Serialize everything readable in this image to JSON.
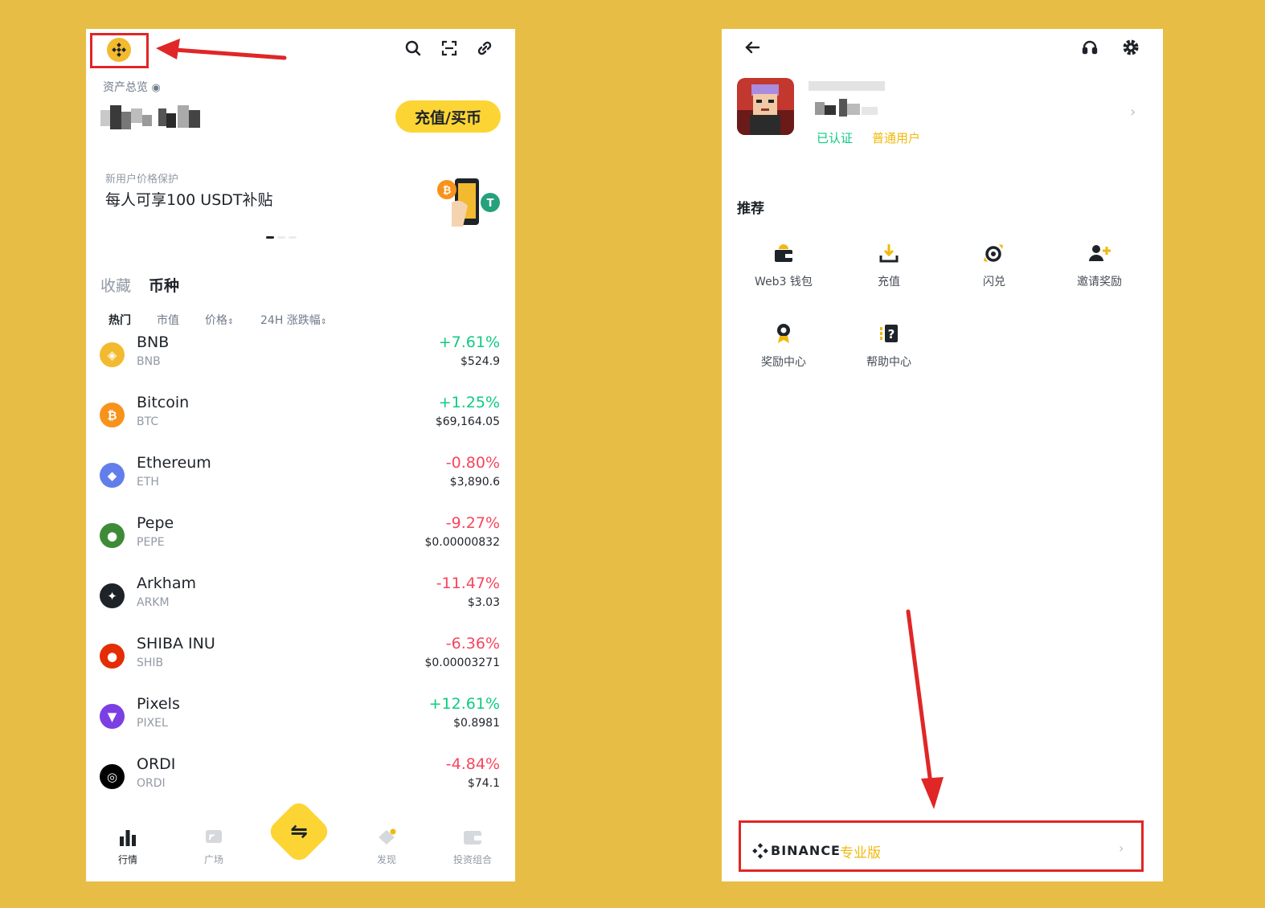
{
  "left": {
    "header": {
      "icons": [
        "binance-logo-icon",
        "search-icon",
        "scan-icon",
        "link-icon"
      ]
    },
    "assets": {
      "overview_label": "资产总览",
      "deposit_button": "充值/买币"
    },
    "promo": {
      "subtitle": "新用户价格保护",
      "title": "每人可享100 USDT补贴"
    },
    "tabs": {
      "favorites": "收藏",
      "coins": "币种"
    },
    "filters": {
      "hot": "热门",
      "market_cap": "市值",
      "price": "价格",
      "change_24h": "24H 涨跌幅"
    },
    "coins": [
      {
        "name": "BNB",
        "symbol": "BNB",
        "change": "+7.61%",
        "price": "$524.9",
        "color": "#f3ba2f"
      },
      {
        "name": "Bitcoin",
        "symbol": "BTC",
        "change": "+1.25%",
        "price": "$69,164.05",
        "color": "#f7931a"
      },
      {
        "name": "Ethereum",
        "symbol": "ETH",
        "change": "-0.80%",
        "price": "$3,890.6",
        "color": "#627eea"
      },
      {
        "name": "Pepe",
        "symbol": "PEPE",
        "change": "-9.27%",
        "price": "$0.00000832",
        "color": "#3d8b37"
      },
      {
        "name": "Arkham",
        "symbol": "ARKM",
        "change": "-11.47%",
        "price": "$3.03",
        "color": "#1e2329"
      },
      {
        "name": "SHIBA INU",
        "symbol": "SHIB",
        "change": "-6.36%",
        "price": "$0.00003271",
        "color": "#e42d04"
      },
      {
        "name": "Pixels",
        "symbol": "PIXEL",
        "change": "+12.61%",
        "price": "$0.8981",
        "color": "#7b3fe4"
      },
      {
        "name": "ORDI",
        "symbol": "ORDI",
        "change": "-4.84%",
        "price": "$74.1",
        "color": "#000000"
      }
    ],
    "nav": {
      "market": "行情",
      "square": "广场",
      "discover": "发现",
      "portfolio": "投资组合"
    }
  },
  "right": {
    "header": {
      "icons": [
        "back-arrow-icon",
        "headset-icon",
        "gear-icon"
      ]
    },
    "profile": {
      "verified": "已认证",
      "level": "普通用户"
    },
    "recommend": {
      "title": "推荐",
      "items": [
        {
          "label": "Web3 钱包",
          "icon": "wallet-icon"
        },
        {
          "label": "充值",
          "icon": "deposit-icon"
        },
        {
          "label": "闪兑",
          "icon": "convert-icon"
        },
        {
          "label": "邀请奖励",
          "icon": "invite-icon"
        },
        {
          "label": "奖励中心",
          "icon": "reward-icon"
        },
        {
          "label": "帮助中心",
          "icon": "help-icon"
        }
      ]
    },
    "footer": {
      "brand": "BINANCE",
      "pro_label": "专业版"
    }
  },
  "colors": {
    "background": "#e7bd45",
    "brand_yellow": "#fcd535",
    "up": "#0ecb81",
    "down": "#f6465d",
    "highlight": "#e02626"
  }
}
